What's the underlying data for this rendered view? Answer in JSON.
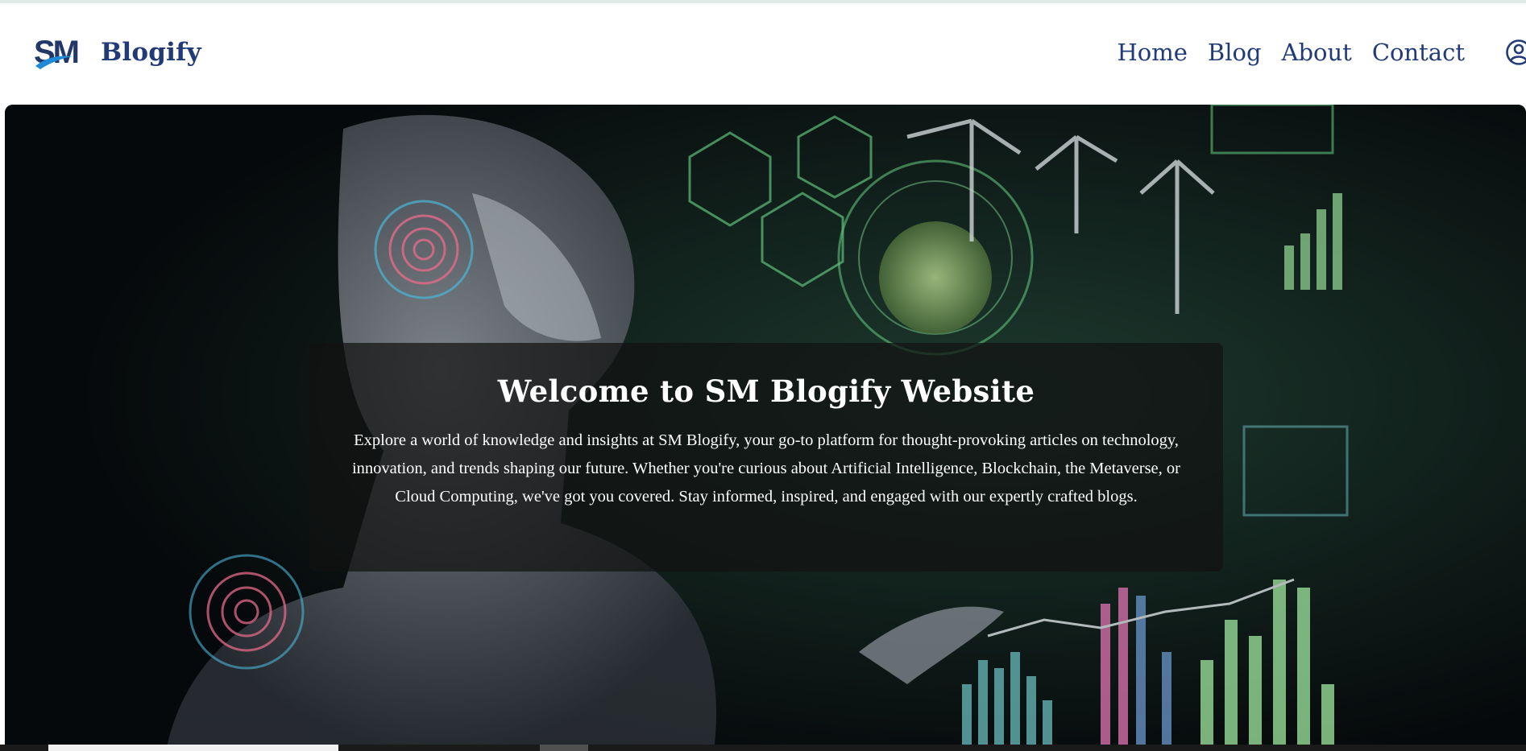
{
  "header": {
    "logo_text": "SM",
    "brand": "Blogify",
    "nav": [
      {
        "label": "Home"
      },
      {
        "label": "Blog"
      },
      {
        "label": "About"
      },
      {
        "label": "Contact"
      }
    ],
    "account_icon": "user-circle-icon"
  },
  "hero": {
    "title": "Welcome to SM Blogify Website",
    "description": "Explore a world of knowledge and insights at SM Blogify, your go-to platform for thought-provoking articles on technology, innovation, and trends shaping our future. Whether you're curious about Artificial Intelligence, Blockchain, the Metaverse, or Cloud Computing, we've got you covered. Stay informed, inspired, and engaged with our expertly crafted blogs."
  },
  "colors": {
    "brand": "#213b78",
    "logo_accent": "#1f8ad8",
    "hero_overlay": "#121212",
    "hero_background": "#070b0d"
  }
}
